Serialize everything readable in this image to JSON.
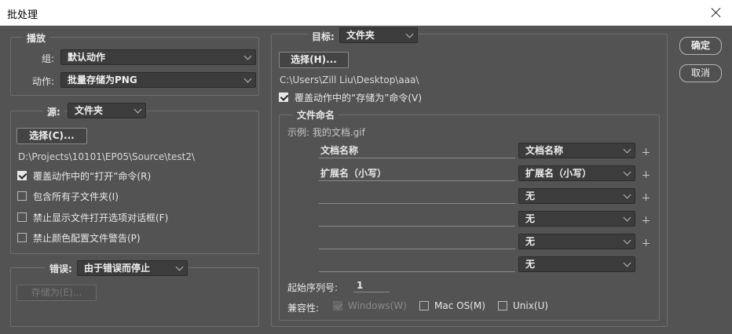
{
  "window": {
    "title": "批处理"
  },
  "buttons": {
    "ok": "确定",
    "cancel": "取消"
  },
  "play": {
    "legend": "播放",
    "group_label": "组:",
    "group_value": "默认动作",
    "action_label": "动作:",
    "action_value": "批量存储为PNG"
  },
  "source": {
    "label": "源:",
    "value": "文件夹",
    "choose_button": "选择(C)...",
    "path": "D:\\Projects\\10101\\EP05\\Source\\test2\\",
    "options": [
      {
        "label": "覆盖动作中的“打开”命令(R)",
        "checked": true
      },
      {
        "label": "包含所有子文件夹(I)",
        "checked": false
      },
      {
        "label": "禁止显示文件打开选项对话框(F)",
        "checked": false
      },
      {
        "label": "禁止颜色配置文件警告(P)",
        "checked": false
      }
    ]
  },
  "errors": {
    "label": "错误:",
    "value": "由于错误而停止",
    "save_as_button": "存储为(E)..."
  },
  "destination": {
    "label": "目标:",
    "value": "文件夹",
    "choose_button": "选择(H)...",
    "path": "C:\\Users\\Zill Liu\\Desktop\\aaa\\",
    "override_label": "覆盖动作中的“存储为”命令(V)",
    "override_checked": true
  },
  "naming": {
    "legend": "文件命名",
    "example": "示例: 我的文档.gif",
    "rows": [
      {
        "field": "文档名称",
        "select": "文档名称",
        "plus": true
      },
      {
        "field": "扩展名（小写）",
        "select": "扩展名（小写）",
        "plus": true
      },
      {
        "field": "",
        "select": "无",
        "plus": true
      },
      {
        "field": "",
        "select": "无",
        "plus": true
      },
      {
        "field": "",
        "select": "无",
        "plus": true
      },
      {
        "field": "",
        "select": "无",
        "plus": false
      }
    ],
    "start_serial_label": "起始序列号:",
    "start_serial_value": "1",
    "compat_label": "兼容性:",
    "compat": [
      {
        "label": "Windows(W)",
        "checked": true,
        "disabled": true
      },
      {
        "label": "Mac OS(M)",
        "checked": false,
        "disabled": false
      },
      {
        "label": "Unix(U)",
        "checked": false,
        "disabled": false
      }
    ]
  }
}
